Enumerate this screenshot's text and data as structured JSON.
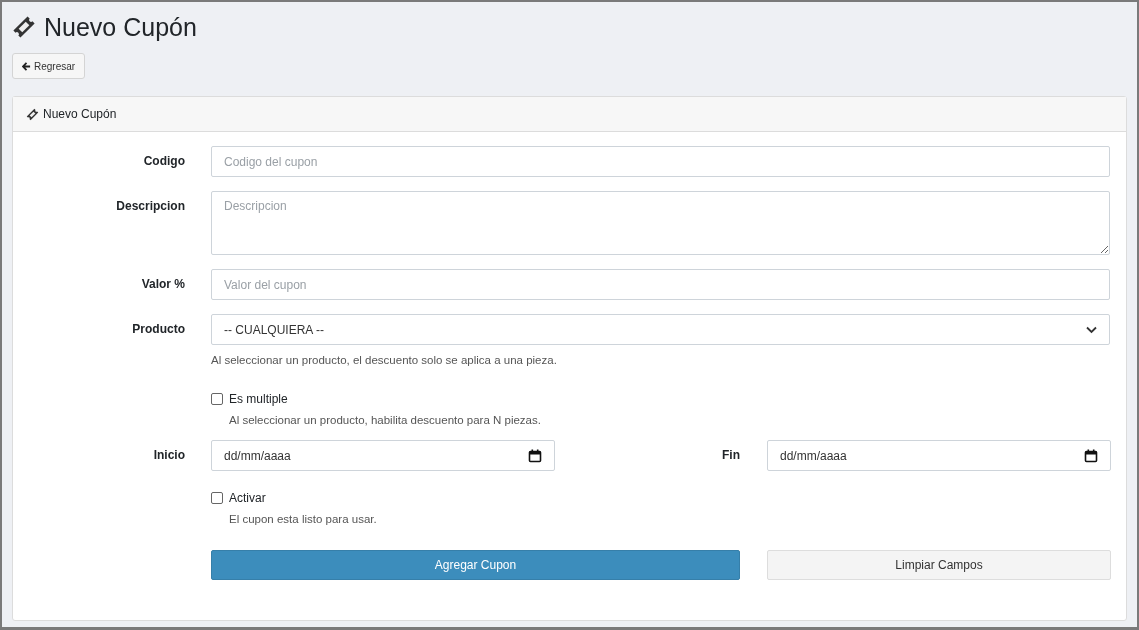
{
  "page": {
    "title": "Nuevo Cupón"
  },
  "back_button": {
    "label": "Regresar"
  },
  "card": {
    "title": "Nuevo Cupón"
  },
  "fields": [
    {
      "kind": "text",
      "label": "Codigo",
      "placeholder": "Codigo del cupon"
    },
    {
      "kind": "textarea",
      "label": "Descripcion",
      "placeholder": "Descripcion"
    },
    {
      "kind": "text",
      "label": "Valor %",
      "placeholder": "Valor del cupon"
    },
    {
      "kind": "select",
      "label": "Producto",
      "value": "-- CUALQUIERA --",
      "help": "Al seleccionar un producto, el descuento solo se aplica a una pieza."
    },
    {
      "kind": "checkbox",
      "label": "Es multiple",
      "checked": false,
      "help": "Al seleccionar un producto, habilita descuento para N piezas."
    },
    {
      "kind": "dates",
      "start_label": "Inicio",
      "start_placeholder": "dd/mm/aaaa",
      "end_label": "Fin",
      "end_placeholder": "dd/mm/aaaa"
    },
    {
      "kind": "checkbox",
      "label": "Activar",
      "checked": false,
      "help": "El cupon esta listo para usar."
    }
  ],
  "buttons": [
    {
      "label": "Agregar Cupon",
      "kind": "primary"
    },
    {
      "label": "Limpiar Campos",
      "kind": "secondary"
    }
  ]
}
